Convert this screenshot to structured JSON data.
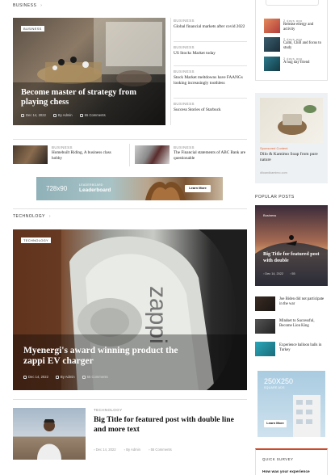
{
  "business": {
    "section_label": "BUSINESS",
    "hero": {
      "badge": "BUSINESS",
      "title": "Become master of strategy from playing chess",
      "date": "Dec 14, 2022",
      "author": "By Admin",
      "comments": "55 Comments"
    },
    "side_list": [
      {
        "cat": "BUSINESS",
        "title": "Global financial markets after covid 2022"
      },
      {
        "cat": "BUSINESS",
        "title": "US Stocks Market today"
      },
      {
        "cat": "BUSINESS",
        "title": "Stock Market meltdowns have FAANGs looking increasingly toothless"
      },
      {
        "cat": "BUSINESS",
        "title": "Success Stories of Starbuck"
      }
    ],
    "mini": [
      {
        "cat": "BUSINESS",
        "title": "Homebuilt Riding, A business class hobby"
      },
      {
        "cat": "BUSINESS",
        "title": "The Financial statements of ABC Bank are questionable"
      }
    ]
  },
  "leaderboard": {
    "size": "728x90",
    "sub": "LEADERBOARD",
    "label": "Leaderboard",
    "button": "Learn More"
  },
  "technology": {
    "section_label": "TECHNOLOGY",
    "hero": {
      "badge": "TECHNOLOGY",
      "title": "Myenergi's award winning product the zappi EV charger",
      "date": "Dec 14, 2022",
      "author": "By Admin",
      "comments": "55 Comments"
    },
    "featured": {
      "cat": "TECHNOLOGY",
      "title": "Big Title for featured post with double line and more text",
      "date": "Dec 14, 2022",
      "author": "By Admin",
      "comments": "55 Comments"
    }
  },
  "sidebar": {
    "top_list": [
      {
        "time": "2 days ago",
        "title": "Release energy and activity"
      },
      {
        "time": "2 days ago",
        "title": "Calm, Chill and focus to study"
      },
      {
        "time": "2 days ago",
        "title": "A hug day friend"
      }
    ],
    "sponsored": {
      "label": "Sponsored Content",
      "title": "Dilo & Kamimo Soap from pure nature",
      "site": "diloandkamimo.com"
    },
    "popular": {
      "section_label": "POPULAR POSTS",
      "hero_cat": "Business",
      "hero_title": "Big Title for featured post with double",
      "hero_date": "Dec 14, 2022",
      "hero_comments": "55",
      "items": [
        {
          "title": "Joe Biden did not participate in the war"
        },
        {
          "title": "Mindset to Successful, Become Lion King"
        },
        {
          "title": "Experience balloon balls in Turkey"
        }
      ]
    },
    "ad250": {
      "size": "250X250",
      "sub": "SQUARE ADS",
      "button": "Learn More"
    },
    "survey": {
      "section_label": "QUICK SURVEY",
      "question": "How was your experience"
    }
  }
}
